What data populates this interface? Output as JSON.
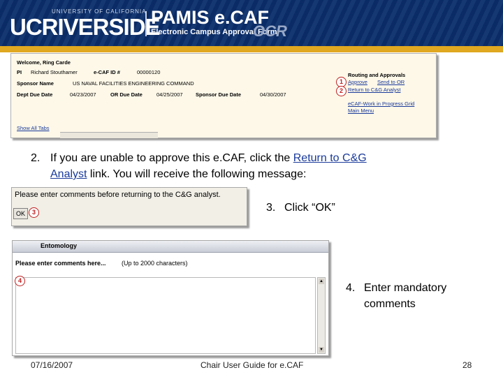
{
  "banner": {
    "logo_uc": "UCRIVERSIDE",
    "logo_university": "UNIVERSITY OF CALIFORNIA",
    "app_name": "PAMIS e.CAF",
    "app_subtitle": "Electronic Campus Approval Form",
    "org": "OCR"
  },
  "screenshot1": {
    "welcome": "Welcome, Ring Carde",
    "pi_label": "PI",
    "pi_value": "Richard Stouthamer",
    "ecaf_label": "e-CAF ID #",
    "ecaf_value": "00000120",
    "sponsor_label": "Sponsor Name",
    "sponsor_value": "US NAVAL FACILITIES ENGINEERING COMMAND",
    "dept_due_label": "Dept Due Date",
    "dept_due_value": "04/23/2007",
    "or_due_label": "OR Due Date",
    "or_due_value": "04/25/2007",
    "sponsor_due_label": "Sponsor Due Date",
    "sponsor_due_value": "04/30/2007",
    "routing_title": "Routing and Approvals",
    "approve_link": "Approve",
    "send_or_link": "Send to OR",
    "return_link": "Return to C&G Analyst",
    "workinprogress_link": "eCAF-Work in Progress Grid",
    "mainmenu_link": "Main Menu",
    "show_all_tabs": "Show All Tabs",
    "badge1": "1",
    "badge2": "2"
  },
  "instruction2": {
    "number": "2.",
    "text_before": "If you are unable to approve this e.CAF, click the",
    "link": "Return to C&G",
    "link2": "Analyst",
    "text_after": "link. You will receive the following message:"
  },
  "screenshot2": {
    "message": "Please enter comments before returning to the C&G analyst.",
    "ok_label": "OK",
    "badge3": "3"
  },
  "instruction3": {
    "number": "3.",
    "text": "Click “OK”"
  },
  "screenshot3": {
    "header": "Entomology",
    "prompt": "Please enter comments here...",
    "limit": "(Up to 2000 characters)",
    "badge4": "4",
    "textarea_value": ""
  },
  "instruction4": {
    "number": "4.",
    "line1": "Enter mandatory",
    "line2": "comments"
  },
  "footer": {
    "date": "07/16/2007",
    "title": "Chair User Guide for e.CAF",
    "page": "28"
  },
  "colors": {
    "banner": "#0a2d6a",
    "gold": "#e0a720",
    "link": "#1a3a9a",
    "badge": "#c02020"
  }
}
